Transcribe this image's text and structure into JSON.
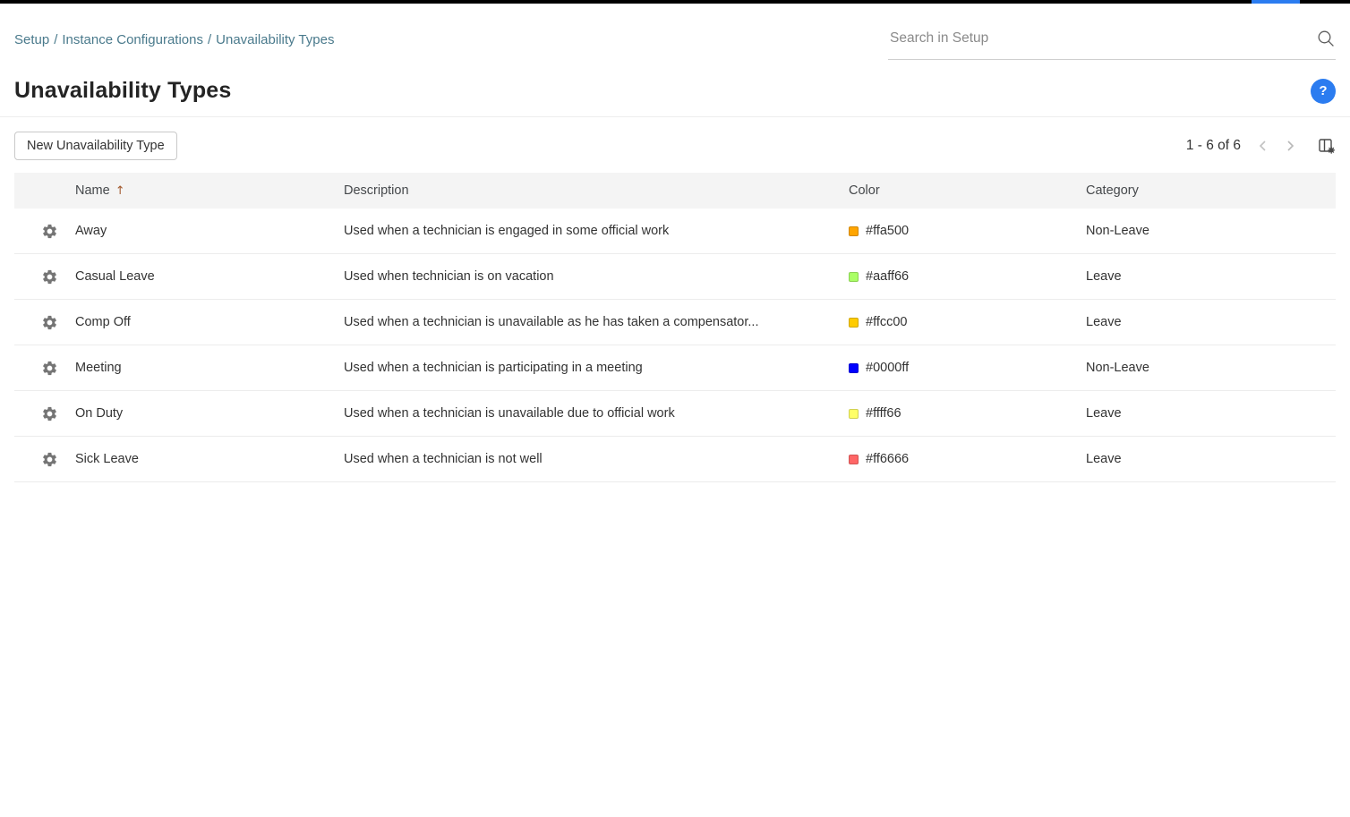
{
  "colors": {
    "accent_blue": "#2b7cf0"
  },
  "breadcrumb": {
    "separator": "/",
    "items": [
      "Setup",
      "Instance Configurations",
      "Unavailability Types"
    ]
  },
  "search": {
    "placeholder": "Search in Setup"
  },
  "page": {
    "title": "Unavailability Types",
    "help_label": "?"
  },
  "toolbar": {
    "new_button_label": "New Unavailability Type",
    "pagination_text": "1 - 6 of 6"
  },
  "table": {
    "headers": [
      "Name",
      "Description",
      "Color",
      "Category"
    ],
    "rows": [
      {
        "name": "Away",
        "description": "Used when a technician is engaged in some official work",
        "color": "#ffa500",
        "category": "Non-Leave"
      },
      {
        "name": "Casual Leave",
        "description": "Used when technician is on vacation",
        "color": "#aaff66",
        "category": "Leave"
      },
      {
        "name": "Comp Off",
        "description": "Used when a technician is unavailable as he has taken a compensator...",
        "color": "#ffcc00",
        "category": "Leave"
      },
      {
        "name": "Meeting",
        "description": "Used when a technician is participating in a meeting",
        "color": "#0000ff",
        "category": "Non-Leave"
      },
      {
        "name": "On Duty",
        "description": "Used when a technician is unavailable due to official work",
        "color": "#ffff66",
        "category": "Leave"
      },
      {
        "name": "Sick Leave",
        "description": "Used when a technician is not well",
        "color": "#ff6666",
        "category": "Leave"
      }
    ]
  }
}
